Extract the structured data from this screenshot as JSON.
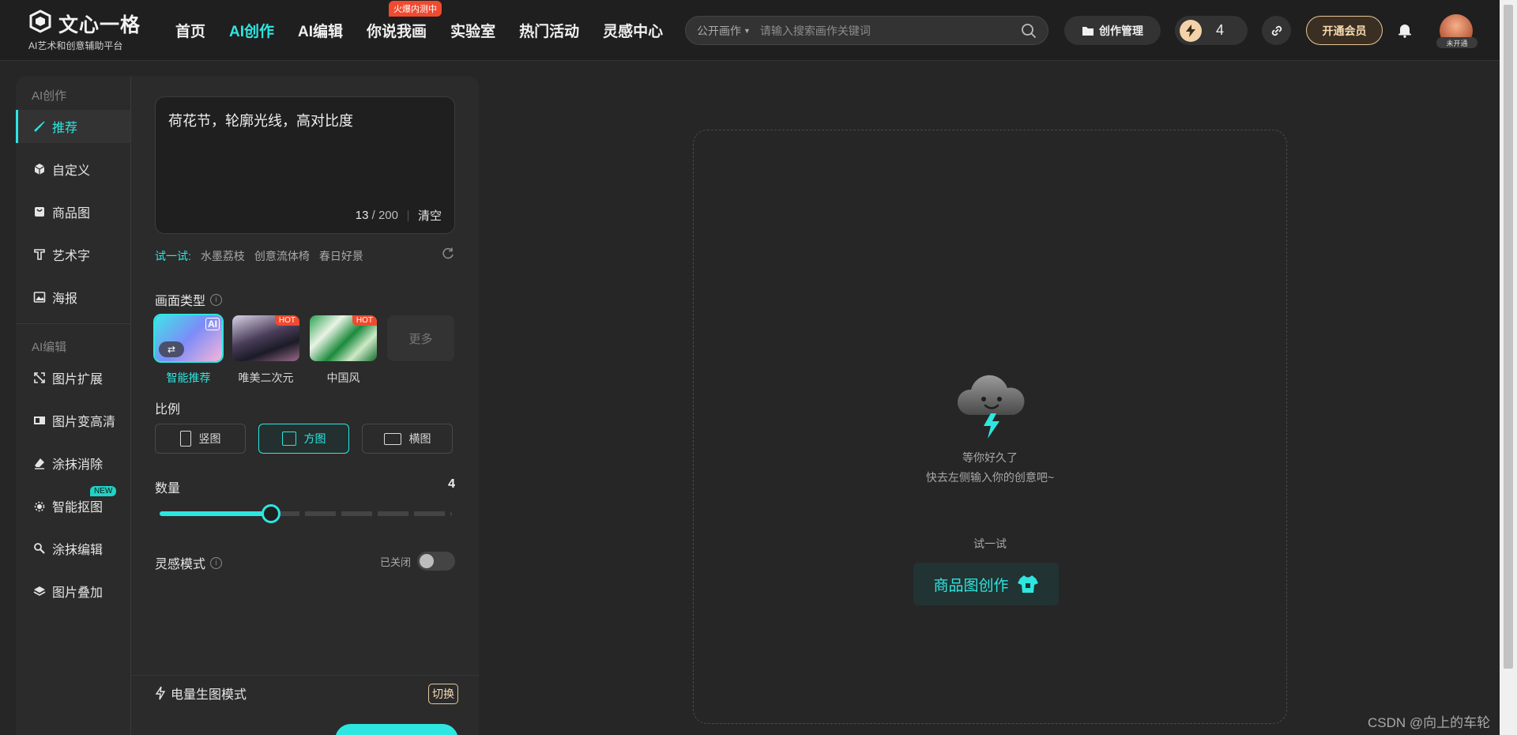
{
  "brand": {
    "name": "文心一格",
    "tagline": "AI艺术和创意辅助平台"
  },
  "nav": {
    "items": [
      {
        "label": "首页"
      },
      {
        "label": "AI创作"
      },
      {
        "label": "AI编辑"
      },
      {
        "label": "你说我画",
        "badge": "火爆内测中"
      },
      {
        "label": "实验室"
      },
      {
        "label": "热门活动"
      },
      {
        "label": "灵感中心"
      }
    ],
    "active": "AI创作"
  },
  "search": {
    "scope": "公开画作",
    "placeholder": "请输入搜索画作关键词"
  },
  "header_actions": {
    "manage_label": "创作管理",
    "credits": "4",
    "vip_label": "开通会员",
    "avatar_tag": "未开通"
  },
  "sidebar": {
    "create_section": "AI创作",
    "create_items": [
      {
        "label": "推荐",
        "icon": "brush-icon"
      },
      {
        "label": "自定义",
        "icon": "cube-icon"
      },
      {
        "label": "商品图",
        "icon": "product-icon"
      },
      {
        "label": "艺术字",
        "icon": "text-art-icon"
      },
      {
        "label": "海报",
        "icon": "poster-icon"
      }
    ],
    "edit_section": "AI编辑",
    "edit_items": [
      {
        "label": "图片扩展",
        "icon": "expand-icon"
      },
      {
        "label": "图片变高清",
        "icon": "hd-icon"
      },
      {
        "label": "涂抹消除",
        "icon": "eraser-icon"
      },
      {
        "label": "智能抠图",
        "icon": "cutout-icon",
        "badge": "NEW"
      },
      {
        "label": "涂抹编辑",
        "icon": "paint-edit-icon"
      },
      {
        "label": "图片叠加",
        "icon": "layers-icon"
      }
    ]
  },
  "prompt": {
    "text": "荷花节，轮廓光线，高对比度",
    "count": "13",
    "max": "/ 200",
    "clear_label": "清空"
  },
  "try": {
    "label": "试一试:",
    "chips": [
      "水墨荔枝",
      "创意流体椅",
      "春日好景"
    ]
  },
  "style": {
    "label": "画面类型",
    "items": [
      {
        "name": "智能推荐",
        "badge": "AI",
        "selected": true
      },
      {
        "name": "唯美二次元",
        "badge": "HOT"
      },
      {
        "name": "中国风",
        "badge": "HOT"
      }
    ],
    "more_label": "更多"
  },
  "ratio": {
    "label": "比例",
    "options": [
      {
        "label": "竖图"
      },
      {
        "label": "方图",
        "selected": true
      },
      {
        "label": "横图"
      }
    ]
  },
  "quantity": {
    "label": "数量",
    "value": "4",
    "max": 8,
    "fill_fraction": 0.38
  },
  "inspiration": {
    "label": "灵感模式",
    "state_label": "已关闭",
    "on": false
  },
  "footer": {
    "mode_label": "电量生图模式",
    "switch_label": "切换"
  },
  "canvas": {
    "empty_title": "等你好久了",
    "empty_sub": "快去左侧输入你的创意吧~",
    "try_label": "试一试",
    "cta_label": "商品图创作"
  },
  "watermark": "CSDN @向上的车轮",
  "colors": {
    "accent": "#2ee6e0",
    "hot": "#f04a2f",
    "gold": "#e7c79a",
    "bg": "#262626",
    "panel": "#2b2b2b"
  }
}
